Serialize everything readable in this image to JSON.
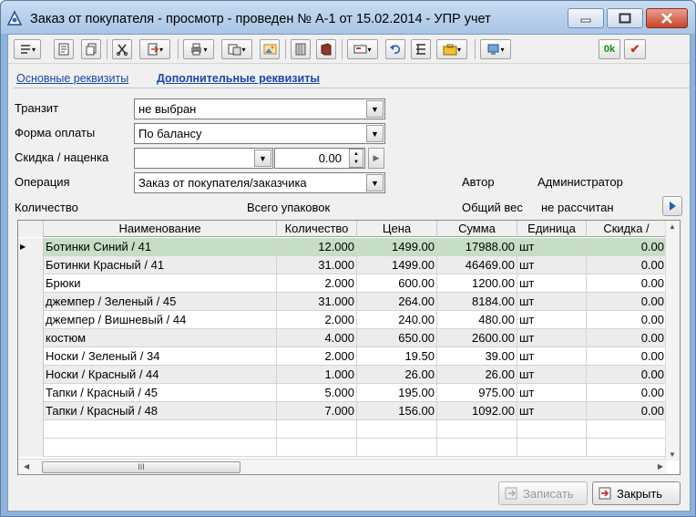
{
  "window": {
    "title": "Заказ от покупателя - просмотр - проведен № А-1 от 15.02.2014 - УПР учет",
    "min_label": "‒",
    "max_label": "☐",
    "close_label": "✕"
  },
  "toolbar": {
    "ok_label": "0k",
    "check_label": "✔"
  },
  "tabs": {
    "main": "Основные реквизиты",
    "extra": "Дополнительные реквизиты"
  },
  "form": {
    "transit_label": "Транзит",
    "transit_value": "не выбран",
    "payment_label": "Форма оплаты",
    "payment_value": "По балансу",
    "discount_label": "Скидка / наценка",
    "discount_value": "",
    "discount_amount": "0.00",
    "operation_label": "Операция",
    "operation_value": "Заказ от покупателя/заказчика",
    "author_label": "Автор",
    "author_value": "Администратор",
    "quantity_label": "Количество",
    "packages_label": "Всего упаковок",
    "weight_label": "Общий вес",
    "weight_value": "не рассчитан"
  },
  "grid": {
    "columns": [
      "Наименование",
      "Количество",
      "Цена",
      "Сумма",
      "Единица",
      "Скидка /"
    ],
    "rows": [
      {
        "name": "Ботинки Синий / 41",
        "qty": "12.000",
        "price": "1499.00",
        "sum": "17988.00",
        "unit": "шт",
        "disc": "0.00"
      },
      {
        "name": "Ботинки Красный / 41",
        "qty": "31.000",
        "price": "1499.00",
        "sum": "46469.00",
        "unit": "шт",
        "disc": "0.00"
      },
      {
        "name": "Брюки",
        "qty": "2.000",
        "price": "600.00",
        "sum": "1200.00",
        "unit": "шт",
        "disc": "0.00"
      },
      {
        "name": "джемпер  / Зеленый / 45",
        "qty": "31.000",
        "price": "264.00",
        "sum": "8184.00",
        "unit": "шт",
        "disc": "0.00"
      },
      {
        "name": "джемпер  / Вишневый / 44",
        "qty": "2.000",
        "price": "240.00",
        "sum": "480.00",
        "unit": "шт",
        "disc": "0.00"
      },
      {
        "name": "костюм",
        "qty": "4.000",
        "price": "650.00",
        "sum": "2600.00",
        "unit": "шт",
        "disc": "0.00"
      },
      {
        "name": "Носки  / Зеленый / 34",
        "qty": "2.000",
        "price": "19.50",
        "sum": "39.00",
        "unit": "шт",
        "disc": "0.00"
      },
      {
        "name": "Носки  / Красный / 44",
        "qty": "1.000",
        "price": "26.00",
        "sum": "26.00",
        "unit": "шт",
        "disc": "0.00"
      },
      {
        "name": "Тапки  / Красный / 45",
        "qty": "5.000",
        "price": "195.00",
        "sum": "975.00",
        "unit": "шт",
        "disc": "0.00"
      },
      {
        "name": "Тапки  / Красный / 48",
        "qty": "7.000",
        "price": "156.00",
        "sum": "1092.00",
        "unit": "шт",
        "disc": "0.00"
      }
    ],
    "scroll_grip": "III"
  },
  "buttons": {
    "save": "Записать",
    "close": "Закрыть"
  },
  "colors": {
    "selected_row": "#c6dec4",
    "alt_row": "#ececec",
    "link": "#1d46a8"
  }
}
